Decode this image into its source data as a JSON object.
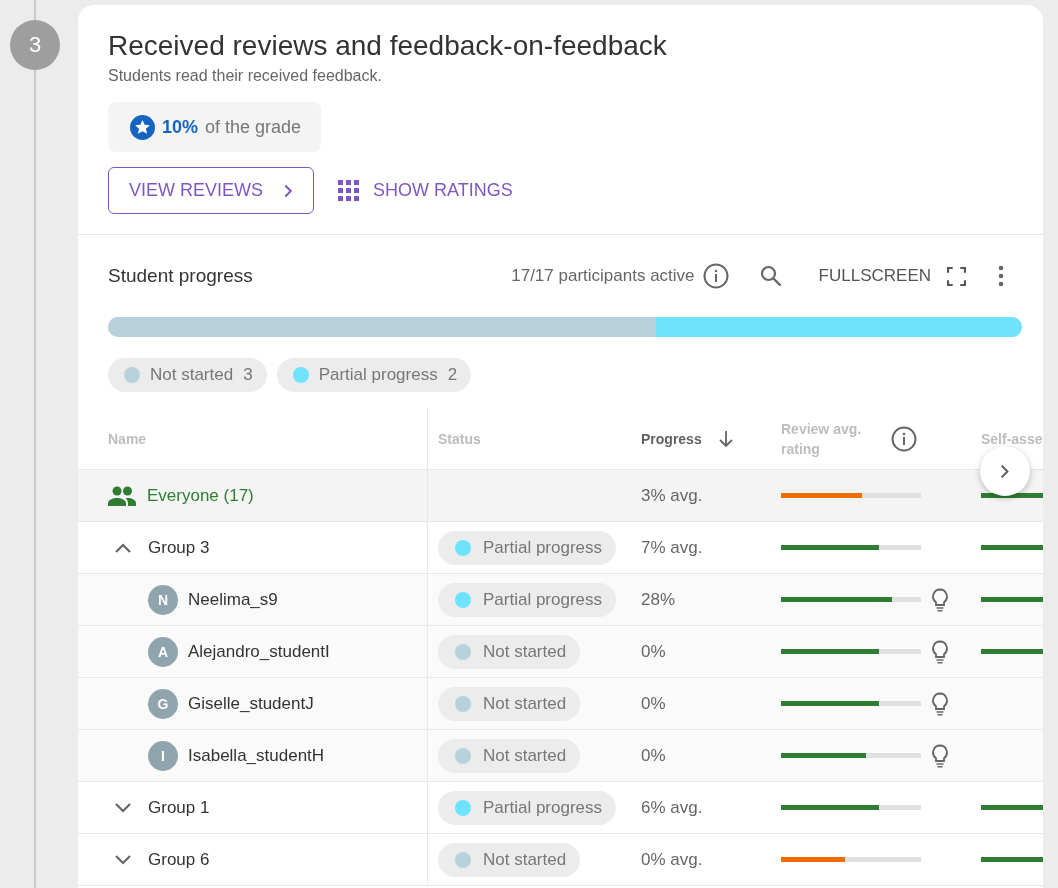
{
  "step": {
    "number": "3"
  },
  "header": {
    "title": "Received reviews and feedback-on-feedback",
    "subtitle": "Students read their received feedback.",
    "grade": {
      "value": "10%",
      "text": "of the grade"
    }
  },
  "actions": {
    "view_reviews": "VIEW REVIEWS",
    "show_ratings": "SHOW RATINGS"
  },
  "progress": {
    "title": "Student progress",
    "participants": "17/17 participants active",
    "fullscreen": "FULLSCREEN",
    "segments": [
      {
        "level": 0.6,
        "color": "#b7d2da"
      },
      {
        "level": 0.4,
        "color": "#6fe3fc"
      }
    ],
    "legend": [
      {
        "label": "Not started",
        "count": "3",
        "color": "#b7d2da"
      },
      {
        "label": "Partial progress",
        "count": "2",
        "color": "#6fe3fc"
      }
    ]
  },
  "table": {
    "columns": [
      {
        "label": "Name",
        "sorted": false,
        "info": false
      },
      {
        "label": "Status",
        "sorted": false,
        "info": false
      },
      {
        "label": "Progress",
        "sorted": true,
        "info": false
      },
      {
        "label": "Review avg. rating",
        "sorted": false,
        "info": true
      },
      {
        "label": "Self-asse",
        "sorted": false,
        "info": false
      }
    ],
    "rows": [
      {
        "kind": "everyone",
        "name": "Everyone (17)",
        "progress": "3% avg.",
        "rating": {
          "level": 0.58,
          "color": "#ef6c00"
        },
        "self_rating": true
      },
      {
        "kind": "group",
        "name": "Group 3",
        "expanded": true,
        "status": {
          "label": "Partial progress",
          "color": "#6fe3fc"
        },
        "progress": "7% avg.",
        "rating": {
          "level": 0.7,
          "color": "#2e7d32"
        },
        "self_rating": true
      },
      {
        "kind": "student",
        "initial": "N",
        "name": "Neelima_s9",
        "status": {
          "label": "Partial progress",
          "color": "#6fe3fc"
        },
        "progress": "28%",
        "rating": {
          "level": 0.79,
          "color": "#2e7d32"
        },
        "self_rating": true
      },
      {
        "kind": "student",
        "initial": "A",
        "name": "Alejandro_studentI",
        "status": {
          "label": "Not started",
          "color": "#b7d2da"
        },
        "progress": "0%",
        "rating": {
          "level": 0.7,
          "color": "#2e7d32"
        },
        "self_rating": true
      },
      {
        "kind": "student",
        "initial": "G",
        "name": "Giselle_studentJ",
        "status": {
          "label": "Not started",
          "color": "#b7d2da"
        },
        "progress": "0%",
        "rating": {
          "level": 0.7,
          "color": "#2e7d32"
        },
        "self_rating": false
      },
      {
        "kind": "student",
        "initial": "I",
        "name": "Isabella_studentH",
        "status": {
          "label": "Not started",
          "color": "#b7d2da"
        },
        "progress": "0%",
        "rating": {
          "level": 0.61,
          "color": "#2e7d32"
        },
        "self_rating": false
      },
      {
        "kind": "group",
        "name": "Group 1",
        "expanded": false,
        "status": {
          "label": "Partial progress",
          "color": "#6fe3fc"
        },
        "progress": "6% avg.",
        "rating": {
          "level": 0.7,
          "color": "#2e7d32"
        },
        "self_rating": true
      },
      {
        "kind": "group",
        "name": "Group 6",
        "expanded": false,
        "status": {
          "label": "Not started",
          "color": "#b7d2da"
        },
        "progress": "0% avg.",
        "rating": {
          "level": 0.46,
          "color": "#ef6c00"
        },
        "self_rating": true
      }
    ]
  }
}
